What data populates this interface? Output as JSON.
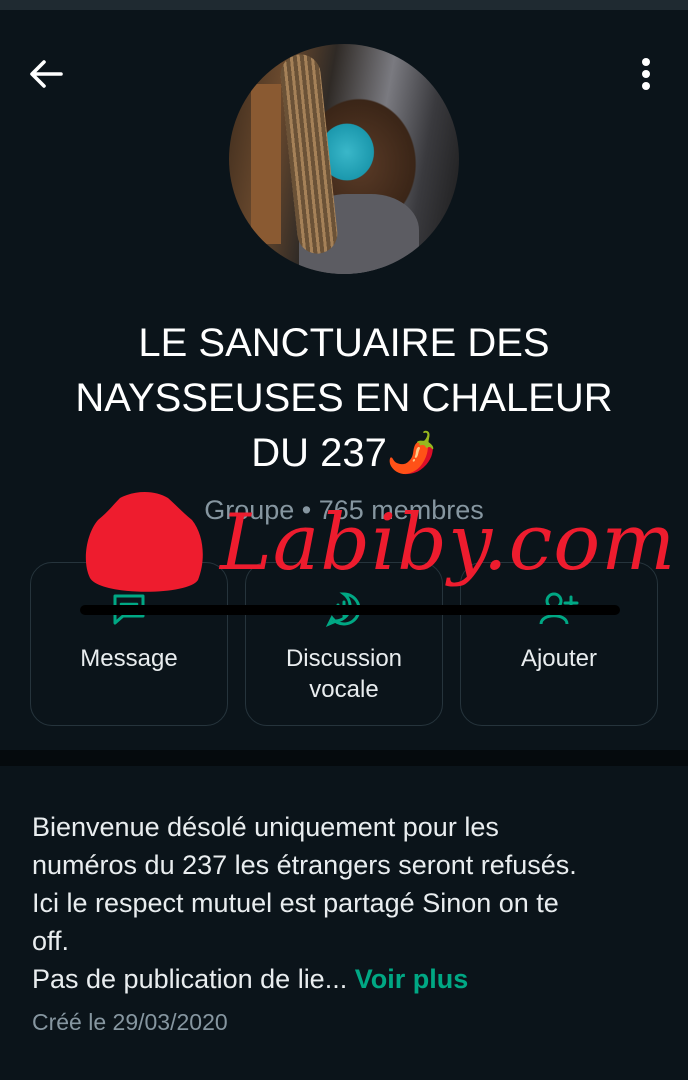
{
  "header": {
    "title": "LE SANCTUAIRE DES\nNAYSSEUSES EN CHALEUR\nDU 237🌶️",
    "subtitle": "Groupe • 765 membres",
    "back_icon": "arrow-left-icon",
    "menu_icon": "more-vertical-icon"
  },
  "actions": [
    {
      "label": "Message",
      "icon": "message-icon"
    },
    {
      "label": "Discussion\nvocale",
      "icon": "voice-chat-icon"
    },
    {
      "label": "Ajouter",
      "icon": "add-person-icon"
    }
  ],
  "description": {
    "text": "Bienvenue désolé uniquement pour les\nnuméros du 237 les étrangers seront refusés.\nIci le respect mutuel est partagé Sinon on te\noff.\nPas de publication de lie... ",
    "see_more": "Voir plus",
    "created": "Créé le 29/03/2020"
  },
  "watermark": {
    "text": "Labiby.com"
  },
  "colors": {
    "background": "#0b141a",
    "accent": "#00a884",
    "secondary_text": "#8696a0",
    "watermark": "#ee1c2e"
  }
}
